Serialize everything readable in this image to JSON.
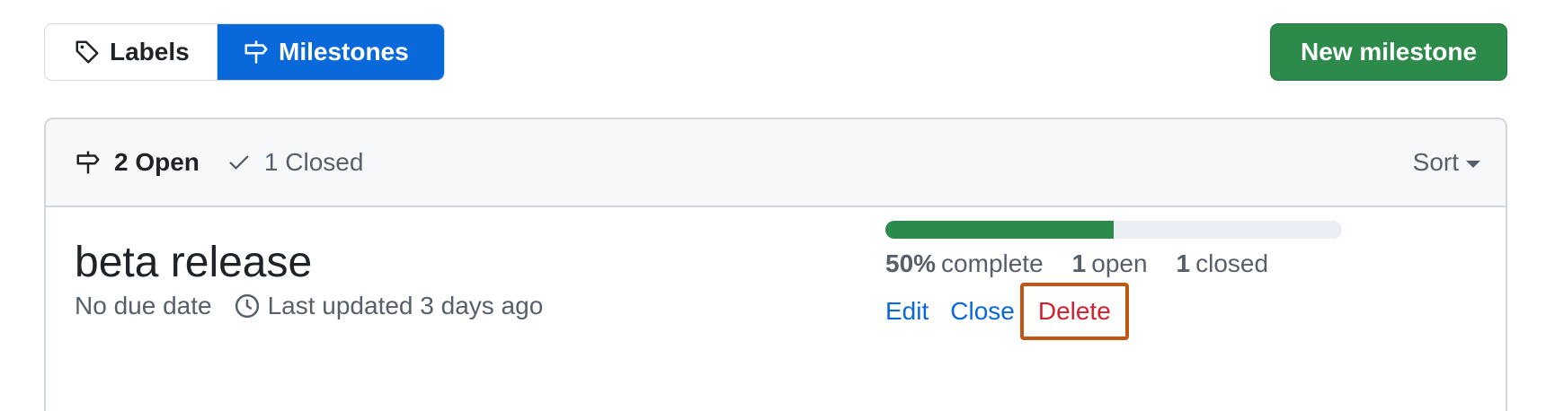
{
  "nav": {
    "labels_label": "Labels",
    "milestones_label": "Milestones",
    "new_milestone_label": "New milestone"
  },
  "filters": {
    "open_label": "2 Open",
    "closed_label": "1 Closed",
    "sort_label": "Sort"
  },
  "milestones": [
    {
      "title": "beta release",
      "due": "No due date",
      "updated": "Last updated 3 days ago",
      "progress_percent": 50,
      "percent_label": "50%",
      "complete_label": "complete",
      "open_count": "1",
      "open_label": "open",
      "closed_count": "1",
      "closed_label": "closed",
      "actions": {
        "edit": "Edit",
        "close": "Close",
        "delete": "Delete"
      }
    }
  ],
  "colors": {
    "primary_blue": "#0969da",
    "success_green": "#2c8a4a",
    "danger_red": "#cf222e",
    "highlight_orange": "#c35512"
  },
  "icons": {
    "labels": "tag-icon",
    "milestones": "milestone-icon",
    "closed": "check-icon",
    "updated": "clock-icon",
    "sort": "caret-down-icon"
  }
}
